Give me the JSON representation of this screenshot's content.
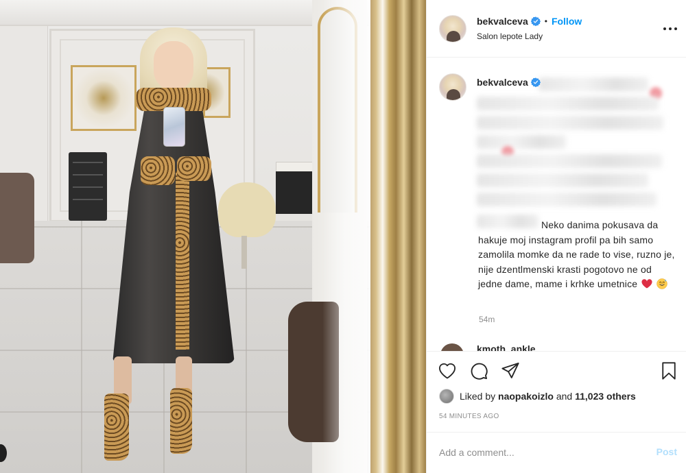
{
  "post": {
    "username": "bekvalceva",
    "separator": "•",
    "follow_label": "Follow",
    "location": "Salon lepote Lady",
    "more_icon": "more-horizontal-icon",
    "verified_icon": "verified-badge-icon"
  },
  "caption": {
    "username": "bekvalceva",
    "text": "Neko danima pokusava da hakuje moj instagram profil pa bih samo zamolila momke da ne rade to vise, ruzno je, nije dzentlmenski krasti pogotovo ne od jedne dame, mame i krhke umetnice",
    "emojis": [
      "red-heart-emoji",
      "sweat-smile-emoji"
    ],
    "timestamp": "54m"
  },
  "next_comment": {
    "username": "kmoth_ankle"
  },
  "actions": {
    "icons": [
      "heart-icon",
      "comment-icon",
      "share-icon",
      "bookmark-icon"
    ],
    "likes_prefix": "Liked by",
    "liked_by_user": "naopakoizlo",
    "likes_middle": "and",
    "likes_count": "11,023 others",
    "time_ago": "54 MINUTES AGO"
  },
  "comment_box": {
    "placeholder": "Add a comment...",
    "post_label": "Post"
  },
  "colors": {
    "accent": "#0095f6",
    "post_disabled": "#b2dffc",
    "text": "#262626",
    "muted": "#8e8e8e",
    "heart_emoji": "#e0245e"
  }
}
